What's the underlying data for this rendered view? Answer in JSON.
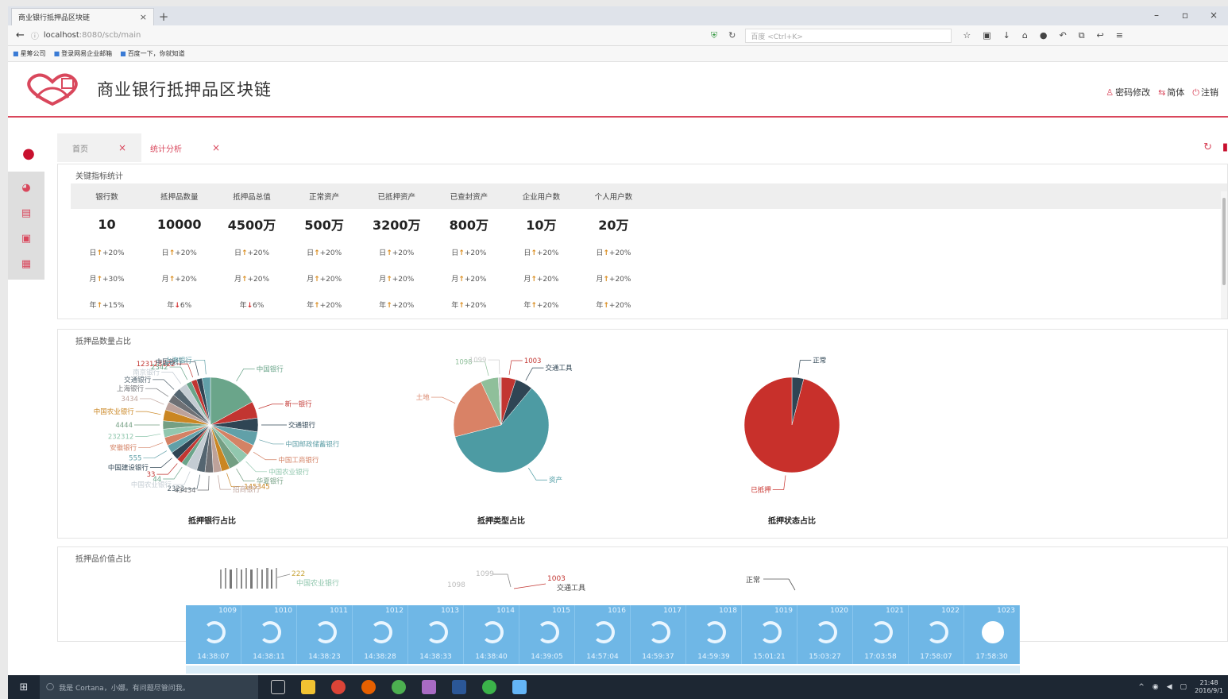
{
  "browser": {
    "tab_title": "商业银行抵押品区块链",
    "tab_close": "×",
    "new_tab": "+",
    "win_min": "–",
    "win_max": "▫",
    "win_close": "×",
    "url_host": "localhost",
    "url_rest": ":8080/scb/main",
    "search_placeholder": "百度 <Ctrl+K>",
    "bookmarks": [
      "星筹公司",
      "登录网易企业邮箱",
      "百度一下，你就知道"
    ]
  },
  "app": {
    "title": "商业银行抵押品区块链",
    "brand_color": "#d9475c",
    "header_links": [
      {
        "icon": "user-icon",
        "label": "密码修改"
      },
      {
        "icon": "swap-icon",
        "label": "简体"
      },
      {
        "icon": "power-icon",
        "label": "注销"
      }
    ]
  },
  "tabs": [
    {
      "label": "首页",
      "close": "×",
      "active": false
    },
    {
      "label": "统计分析",
      "close": "×",
      "active": true
    }
  ],
  "kpi": {
    "title": "关键指标统计",
    "headers": [
      "银行数",
      "抵押品数量",
      "抵押品总值",
      "正常资产",
      "已抵押资产",
      "已查封资产",
      "企业用户数",
      "个人用户数"
    ],
    "values": [
      "10",
      "10000",
      "4500万",
      "500万",
      "3200万",
      "800万",
      "10万",
      "20万"
    ],
    "day": [
      {
        "p": "日",
        "d": "up",
        "v": "+20%"
      },
      {
        "p": "日",
        "d": "up",
        "v": "+20%"
      },
      {
        "p": "日",
        "d": "up",
        "v": "+20%"
      },
      {
        "p": "日",
        "d": "up",
        "v": "+20%"
      },
      {
        "p": "日",
        "d": "up",
        "v": "+20%"
      },
      {
        "p": "日",
        "d": "up",
        "v": "+20%"
      },
      {
        "p": "日",
        "d": "up",
        "v": "+20%"
      },
      {
        "p": "日",
        "d": "up",
        "v": "+20%"
      }
    ],
    "month": [
      {
        "p": "月",
        "d": "up",
        "v": "+30%"
      },
      {
        "p": "月",
        "d": "up",
        "v": "+20%"
      },
      {
        "p": "月",
        "d": "up",
        "v": "+20%"
      },
      {
        "p": "月",
        "d": "up",
        "v": "+20%"
      },
      {
        "p": "月",
        "d": "up",
        "v": "+20%"
      },
      {
        "p": "月",
        "d": "up",
        "v": "+20%"
      },
      {
        "p": "月",
        "d": "up",
        "v": "+20%"
      },
      {
        "p": "月",
        "d": "up",
        "v": "+20%"
      }
    ],
    "year": [
      {
        "p": "年",
        "d": "up",
        "v": "+15%"
      },
      {
        "p": "年",
        "d": "down",
        "v": "6%"
      },
      {
        "p": "年",
        "d": "down",
        "v": "6%"
      },
      {
        "p": "年",
        "d": "up",
        "v": "+20%"
      },
      {
        "p": "年",
        "d": "up",
        "v": "+20%"
      },
      {
        "p": "年",
        "d": "up",
        "v": "+20%"
      },
      {
        "p": "年",
        "d": "up",
        "v": "+20%"
      },
      {
        "p": "年",
        "d": "up",
        "v": "+20%"
      }
    ]
  },
  "pies_panel": {
    "title": "抵押品数量占比",
    "captions": [
      "抵押银行占比",
      "抵押类型占比",
      "抵押状态占比"
    ]
  },
  "value_panel": {
    "title": "抵押品价值占比",
    "labels": [
      "222",
      "中国农业银行",
      "1099",
      "1003",
      "交通工具",
      "1098",
      "正常"
    ]
  },
  "chart_data": [
    {
      "type": "pie",
      "title": "抵押银行占比",
      "labels": [
        "中国银行",
        "新一银行",
        "交通银行",
        "中国邮政储蓄银行",
        "中国工商银行",
        "中国农业银行",
        "华夏银行",
        "145345",
        "招商银行",
        "43434",
        "2323",
        "中国农业银行",
        "44",
        "33",
        "中国建设银行",
        "555",
        "安徽银行",
        "232312",
        "4444",
        "中国农业银行",
        "3434",
        "上海银行",
        "交通银行",
        "南京银行",
        "2342",
        "123123122",
        "中国银行",
        "上海银行"
      ],
      "values": [
        18,
        6,
        5,
        5,
        4,
        4,
        4,
        3,
        3,
        3,
        3,
        4,
        2,
        2,
        3,
        3,
        3,
        3,
        3,
        4,
        3,
        3,
        3,
        3,
        2,
        2,
        2,
        3
      ],
      "colors": [
        "#6aa58a",
        "#c23531",
        "#2f4554",
        "#61a0a8",
        "#d48265",
        "#91c7ae",
        "#749f83",
        "#ca8622",
        "#bda29a",
        "#6e7074",
        "#546570",
        "#c4ccd3"
      ]
    },
    {
      "type": "pie",
      "title": "抵押类型占比",
      "labels": [
        "1003",
        "交通工具",
        "资产",
        "土地",
        "1098",
        "1099"
      ],
      "values": [
        5,
        6,
        60,
        22,
        6,
        1
      ],
      "colors": [
        "#c23531",
        "#2f4554",
        "#4d9ba3",
        "#d98266",
        "#8fbf9a",
        "#c9c9c9"
      ]
    },
    {
      "type": "pie",
      "title": "抵押状态占比",
      "labels": [
        "正常",
        "已抵押"
      ],
      "values": [
        4,
        96
      ],
      "colors": [
        "#2f4554",
        "#c8302b"
      ]
    }
  ],
  "blocks": [
    {
      "num": "1009",
      "time": "14:38:07"
    },
    {
      "num": "1010",
      "time": "14:38:11"
    },
    {
      "num": "1011",
      "time": "14:38:23"
    },
    {
      "num": "1012",
      "time": "14:38:28"
    },
    {
      "num": "1013",
      "time": "14:38:33"
    },
    {
      "num": "1014",
      "time": "14:38:40"
    },
    {
      "num": "1015",
      "time": "14:39:05"
    },
    {
      "num": "1016",
      "time": "14:57:04"
    },
    {
      "num": "1017",
      "time": "14:59:37"
    },
    {
      "num": "1018",
      "time": "14:59:39"
    },
    {
      "num": "1019",
      "time": "15:01:21"
    },
    {
      "num": "1020",
      "time": "15:03:27"
    },
    {
      "num": "1021",
      "time": "17:03:58"
    },
    {
      "num": "1022",
      "time": "17:58:07"
    },
    {
      "num": "1023",
      "time": "17:58:30"
    }
  ],
  "taskbar": {
    "cortana": "我是 Cortana，小娜。有问题尽管问我。",
    "clock_time": "21:48",
    "clock_date": "2016/9/1"
  }
}
